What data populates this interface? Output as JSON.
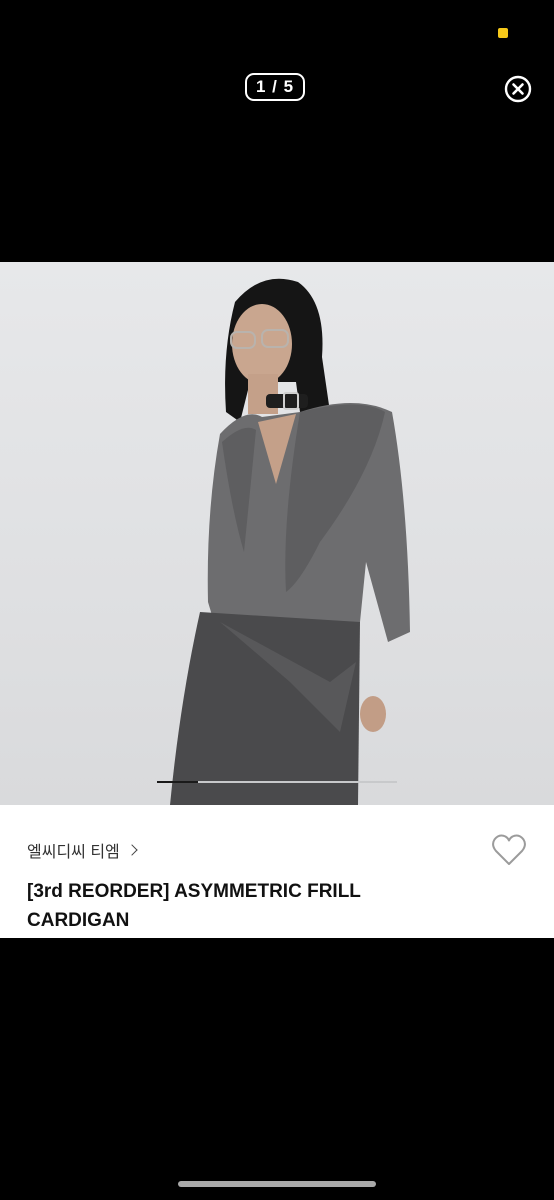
{
  "viewer": {
    "counter": "1 / 5",
    "current_index": 1,
    "total": 5,
    "progress_fraction": 0.17
  },
  "product": {
    "brand": "엘씨디씨 티엠",
    "title": "[3rd REORDER] ASYMMETRIC FRILL CARDIGAN"
  },
  "icons": {
    "close": "close-circle-icon",
    "brand_chevron": "chevron-right-icon",
    "wishlist": "heart-outline-icon"
  },
  "colors": {
    "background": "#000000",
    "status_indicator": "#f6c91a",
    "panel": "#ffffff"
  }
}
